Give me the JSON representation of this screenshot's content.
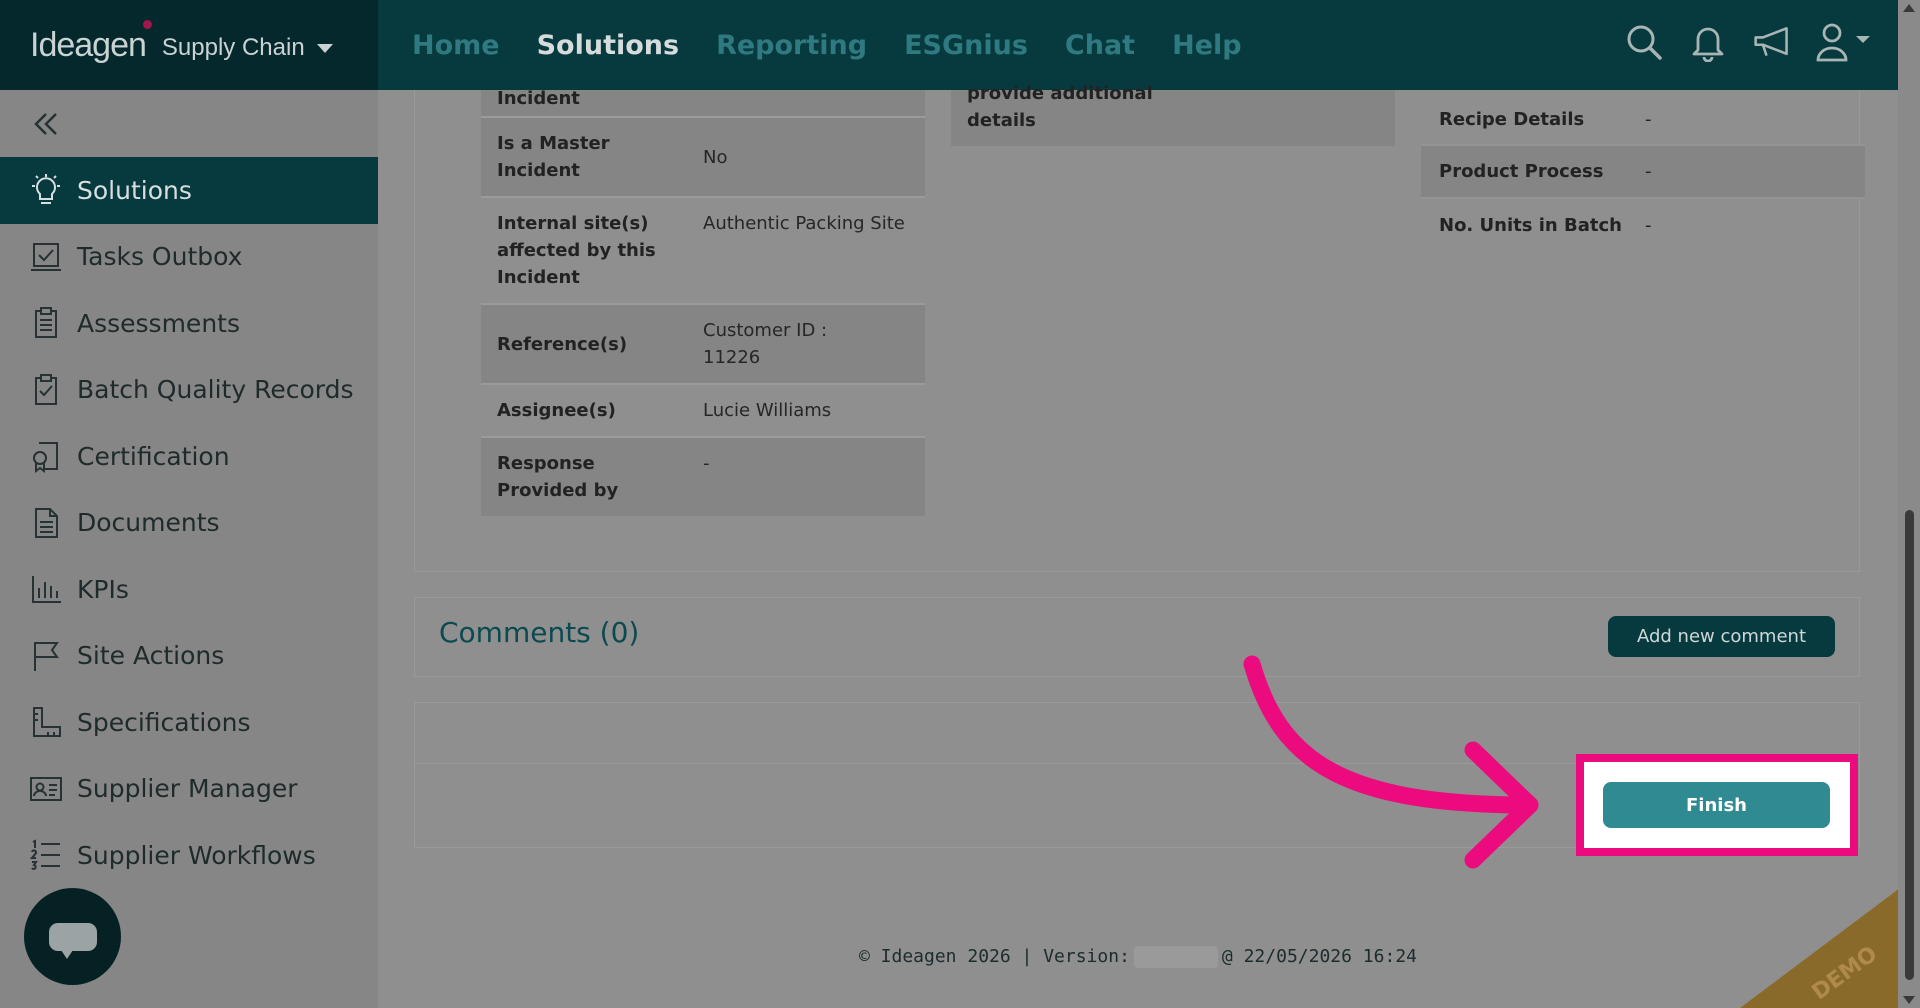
{
  "brand": {
    "logo": "Ideagen",
    "product": "Supply Chain"
  },
  "nav": [
    {
      "label": "Home",
      "active": false
    },
    {
      "label": "Solutions",
      "active": true
    },
    {
      "label": "Reporting",
      "active": false
    },
    {
      "label": "ESGnius",
      "active": false
    },
    {
      "label": "Chat",
      "active": false
    },
    {
      "label": "Help",
      "active": false
    }
  ],
  "top_icons": [
    "search-icon",
    "bell-icon",
    "megaphone-icon",
    "user-icon"
  ],
  "sidebar": {
    "items": [
      {
        "label": "Solutions",
        "icon": "lightbulb-icon",
        "active": true
      },
      {
        "label": "Tasks Outbox",
        "icon": "tasks-icon"
      },
      {
        "label": "Assessments",
        "icon": "clipboard-icon"
      },
      {
        "label": "Batch Quality Records",
        "icon": "clipboard-check-icon"
      },
      {
        "label": "Certification",
        "icon": "certificate-icon"
      },
      {
        "label": "Documents",
        "icon": "document-icon"
      },
      {
        "label": "KPIs",
        "icon": "bar-chart-icon"
      },
      {
        "label": "Site Actions",
        "icon": "flag-icon"
      },
      {
        "label": "Specifications",
        "icon": "ruler-icon"
      },
      {
        "label": "Supplier Manager",
        "icon": "id-card-icon"
      },
      {
        "label": "Supplier Workflows",
        "icon": "numbered-list-icon"
      }
    ]
  },
  "details": {
    "cut_label": "Incident",
    "rows": [
      {
        "label": "Is a Master Incident",
        "value": "No"
      },
      {
        "label": "Internal site(s) affected by this Incident",
        "value": "Authentic Packing Site"
      },
      {
        "label": "Reference(s)",
        "value": "Customer ID : 11226"
      },
      {
        "label": "Assignee(s)",
        "value": "Lucie Williams"
      },
      {
        "label": "Response Provided by",
        "value": "-"
      }
    ]
  },
  "middle": {
    "text": "provide additional details"
  },
  "right_details": [
    {
      "label": "Recipe Details",
      "value": "-"
    },
    {
      "label": "Product Process",
      "value": "-"
    },
    {
      "label": "No. Units in Batch",
      "value": "-"
    }
  ],
  "comments": {
    "title": "Comments (0)",
    "add_label": "Add new comment"
  },
  "finish_label": "Finish",
  "footer": {
    "left": "© Ideagen 2026 | Version:",
    "right": "@ 22/05/2026 16:24"
  },
  "demo_label": "DEMO",
  "colors": {
    "highlight": "#ec0b7f",
    "brand_dark": "#073a3e",
    "finish": "#2f8a91"
  }
}
